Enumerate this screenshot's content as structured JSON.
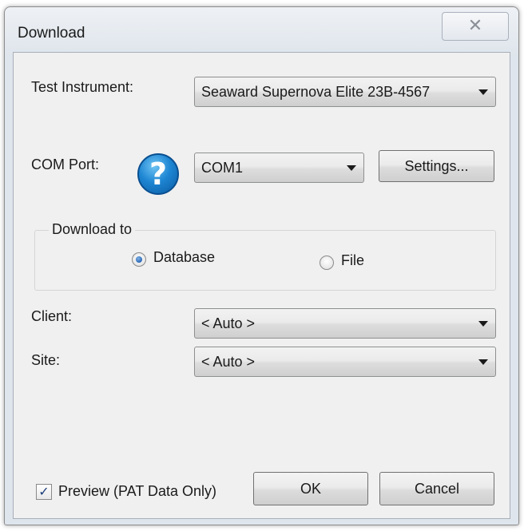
{
  "window": {
    "title": "Download",
    "close_glyph": "✕"
  },
  "test_instrument": {
    "label": "Test Instrument:",
    "value": "Seaward Supernova Elite 23B-4567"
  },
  "com_port": {
    "label": "COM Port:",
    "value": "COM1",
    "help_icon": "question-mark-icon",
    "help_glyph": "?",
    "settings_label": "Settings..."
  },
  "download_to": {
    "group_label": "Download to",
    "options": [
      {
        "label": "Database",
        "checked": true
      },
      {
        "label": "File",
        "checked": false
      }
    ]
  },
  "client": {
    "label": "Client:",
    "value": "< Auto >"
  },
  "site": {
    "label": "Site:",
    "value": "< Auto >"
  },
  "preview": {
    "label": "Preview (PAT Data Only)",
    "checked": true,
    "check_glyph": "✓"
  },
  "buttons": {
    "ok_label": "OK",
    "cancel_label": "Cancel"
  },
  "colors": {
    "help_icon_blue": "#1e86d3",
    "radio_selected_blue": "#2a66b5",
    "client_area_bg": "#f0f0f0"
  }
}
